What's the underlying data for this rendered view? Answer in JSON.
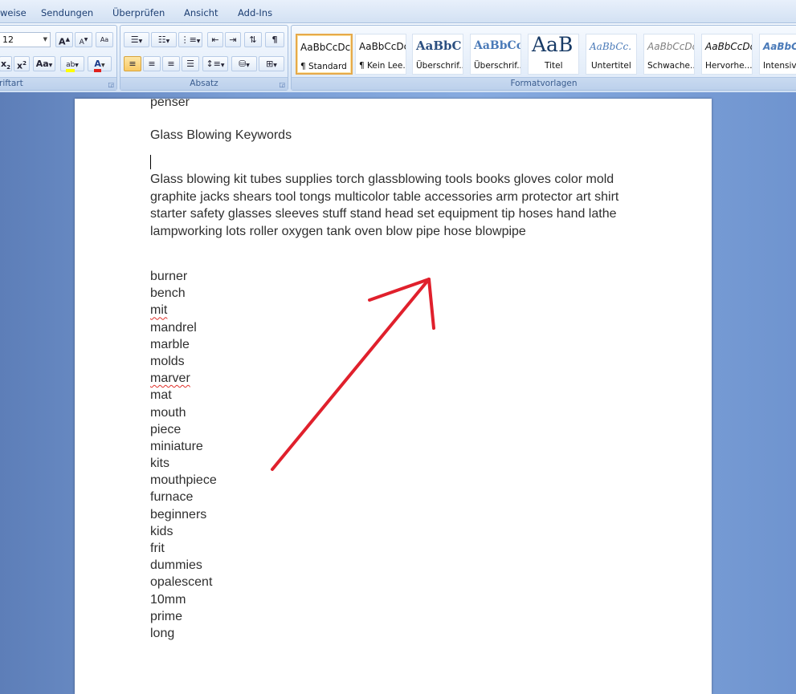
{
  "tabs": [
    "weise",
    "Sendungen",
    "Überprüfen",
    "Ansicht",
    "Add-Ins"
  ],
  "ribbon": {
    "font_group": {
      "label": "riftart",
      "font_size": "12",
      "grow_label": "A",
      "shrink_label": "A",
      "clear_label": "Aa",
      "subscript_label": "x",
      "superscript_label": "x",
      "case_label": "Aa",
      "highlight_label": "ab",
      "font_color_label": "A",
      "highlight_color": "#ffff00",
      "font_color": "#e0201c"
    },
    "paragraph_group": {
      "label": "Absatz",
      "pilcrow": "¶"
    },
    "styles_group": {
      "label": "Formatvorlagen",
      "styles": [
        {
          "sample": "AaBbCcDc",
          "name": "¶ Standard"
        },
        {
          "sample": "AaBbCcDc",
          "name": "¶ Kein Lee..."
        },
        {
          "sample": "AaBbC",
          "name": "Überschrif..."
        },
        {
          "sample": "AaBbCc",
          "name": "Überschrif..."
        },
        {
          "sample": "AaB",
          "name": "Titel"
        },
        {
          "sample": "AaBbCc.",
          "name": "Untertitel"
        },
        {
          "sample": "AaBbCcDc",
          "name": "Schwache..."
        },
        {
          "sample": "AaBbCcDc",
          "name": "Hervorhe..."
        },
        {
          "sample": "AaBbCc",
          "name": "Intensiv"
        }
      ]
    }
  },
  "document": {
    "first_line": "penser",
    "heading": "Glass Blowing Keywords",
    "paragraph": "Glass blowing kit tubes supplies torch glassblowing tools books gloves color mold graphite jacks shears tool tongs multicolor table accessories arm protector art shirt starter safety glasses sleeves stuff stand head set equipment tip hoses hand lathe lampworking lots roller oxygen tank oven blow pipe hose blowpipe",
    "keywords": [
      "burner",
      "bench",
      "mit",
      "mandrel",
      "marble",
      "molds",
      "marver",
      "mat",
      "mouth",
      "piece",
      "miniature",
      "kits",
      "mouthpiece",
      "furnace",
      "beginners",
      "kids",
      "frit",
      "dummies",
      "opalescent",
      "10mm",
      "prime",
      "long"
    ]
  },
  "annotation": {
    "arrow_color": "#e0202c"
  }
}
